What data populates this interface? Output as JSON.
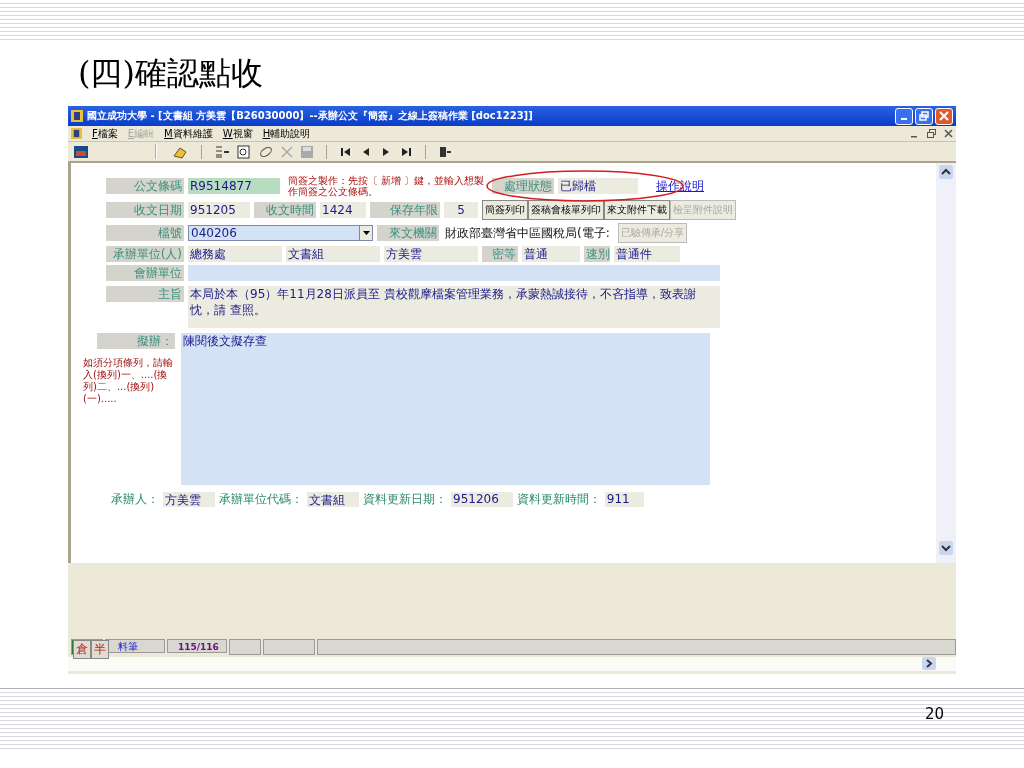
{
  "slide": {
    "title": "(四)確認點收",
    "page_number": "20"
  },
  "window": {
    "title": "國立成功大學 - [文書組 方美雲【B26030000】--承辦公文『簡簽』之線上簽稿作業 [doc1223]]",
    "menu": [
      {
        "key": "F",
        "label": "檔案",
        "disabled": false
      },
      {
        "key": "E",
        "label": "編輯",
        "disabled": true
      },
      {
        "key": "M",
        "label": "資料維護",
        "disabled": false
      },
      {
        "key": "W",
        "label": "視窗",
        "disabled": false
      },
      {
        "key": "H",
        "label": "輔助說明",
        "disabled": false
      }
    ]
  },
  "form": {
    "barcode": {
      "label": "公文條碼",
      "value": "R9514877"
    },
    "hint": "簡簽之製作：先按〔 新增 〕鍵，並輸入想製作簡簽之公文條碼。",
    "status": {
      "label": "處理狀態",
      "value": "已歸檔"
    },
    "help_link": "操作說明",
    "receive_date": {
      "label": "收文日期",
      "value": "951205"
    },
    "receive_time": {
      "label": "收文時間",
      "value": "1424"
    },
    "retention": {
      "label": "保存年限",
      "value": "5"
    },
    "buttons": [
      {
        "label": "簡簽列印",
        "disabled": false
      },
      {
        "label": "簽稿會核單列印",
        "disabled": false
      },
      {
        "label": "來文附件下載",
        "disabled": false
      },
      {
        "label": "檢呈附件說明",
        "disabled": true
      }
    ],
    "file_no": {
      "label": "檔號",
      "value": "040206"
    },
    "sender": {
      "label": "來文機關",
      "value": "財政部臺灣省中區國稅局(電子:"
    },
    "share_button": {
      "label": "已驗傳承/分享",
      "disabled": true
    },
    "handler_unit": {
      "label": "承辦單位(人)",
      "values": [
        "總務處",
        "文書組",
        "方美雲"
      ]
    },
    "secrecy": {
      "label": "密等",
      "value": "普通"
    },
    "speed": {
      "label": "速別",
      "value": "普通件"
    },
    "co_unit": {
      "label": "會辦單位"
    },
    "subject": {
      "label": "主旨",
      "value": "本局於本（95）年11月28日派員至 貴校觀摩檔案管理業務，承蒙熱誠接待，不吝指導，致表謝忱，請 查照。"
    },
    "proposal": {
      "label": "擬辦：",
      "value": "陳閱後文擬存查"
    },
    "proposal_note": "如須分項條列，請輸入(換列)一、....(換列)二、...(換列)(一).....",
    "footer": [
      {
        "label": "承辦人：",
        "value": "方美雲"
      },
      {
        "label": "承辦單位代碼：",
        "value": "文書組"
      },
      {
        "label": "資料更新日期：",
        "value": "951206"
      },
      {
        "label": "資料更新時間：",
        "value": "911"
      }
    ]
  },
  "status_bar": {
    "ime": [
      "倉",
      "半"
    ],
    "record_label": "料筆",
    "record": "115/116"
  }
}
